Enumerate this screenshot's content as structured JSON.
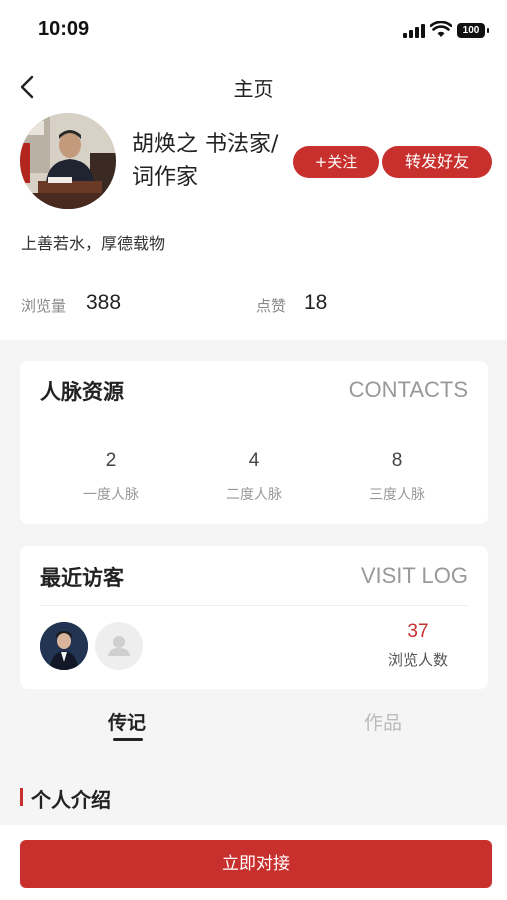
{
  "status_bar": {
    "time": "10:09",
    "battery": "100"
  },
  "nav": {
    "title": "主页"
  },
  "profile": {
    "name_line1": "胡焕之 书法家/",
    "name_line2": "词作家",
    "follow_label": "+关注",
    "share_label": "转发好友",
    "motto": "上善若水，厚德载物"
  },
  "stats": {
    "views_label": "浏览量",
    "views_value": "388",
    "likes_label": "点赞",
    "likes_value": "18"
  },
  "contacts": {
    "title": "人脉资源",
    "title_en": "CONTACTS",
    "items": [
      {
        "value": "2",
        "label": "一度人脉"
      },
      {
        "value": "4",
        "label": "二度人脉"
      },
      {
        "value": "8",
        "label": "三度人脉"
      }
    ]
  },
  "visits": {
    "title": "最近访客",
    "title_en": "VISIT LOG",
    "count": "37",
    "count_label": "浏览人数"
  },
  "tabs": [
    {
      "label": "传记",
      "active": true
    },
    {
      "label": "作品",
      "active": false
    }
  ],
  "section": {
    "title": "个人介绍"
  },
  "cta_label": "立即对接",
  "colors": {
    "accent": "#c8302e",
    "muted": "#999999",
    "background": "#f5f5f5"
  }
}
